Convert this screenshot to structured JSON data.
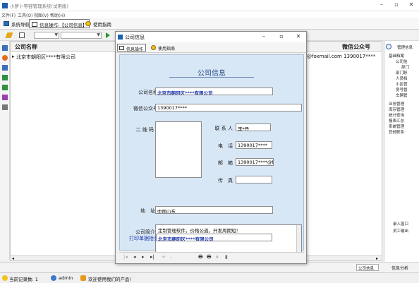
{
  "app": {
    "title": "小萝卜等容管理系统(试用版)"
  },
  "menu": [
    "文件(F)",
    "工具(O)",
    "视图(V)",
    "帮助(H)"
  ],
  "tabs": [
    {
      "label": "系统导航",
      "active": false
    },
    {
      "label": "信息操作-【公司信息】",
      "active": true
    },
    {
      "label": "使用指南",
      "active": false
    }
  ],
  "grid": {
    "col_company": "公司名称",
    "col_wechat": "微信公众号",
    "row1_company": "北京市朝阳区****有限公司",
    "row1_tail": "@foxmail.com 1390017****"
  },
  "right_panel": {
    "header": "管理信息",
    "tree": [
      "基础档案",
      "公司信",
      "部门",
      "部门职",
      "人员档",
      "小区管",
      "房号管",
      "车辆管",
      "业务管理",
      "库存管理",
      "统计查询",
      "报表汇总",
      "系统管理",
      "其他联系"
    ],
    "bottom": [
      "录入窗口",
      "员工输出"
    ]
  },
  "bottom_bar": {
    "dropdown": "公司信息",
    "right_label": "信息分析"
  },
  "status": {
    "records": "当前记录数: 1",
    "user": "admin",
    "welcome": "欢迎使用我们的产品!"
  },
  "dialog": {
    "title": "公司信息",
    "toolbar": [
      {
        "label": "信息操作",
        "active": true
      },
      {
        "label": "使用指南",
        "active": false
      }
    ],
    "form_title": "公司信息",
    "fields": {
      "company_label": "公司名称",
      "company_value": "北京市朝阳区****有限公司",
      "wechat_label": "微信公众号",
      "wechat_value": "1390017****",
      "qrcode_label": "二 维 码",
      "contact_label": "联 系 人",
      "contact_value": "李*丹",
      "phone_label": "电　话",
      "phone_value": "1390017****",
      "email_label": "邮　箱",
      "email_value": "1390017****@fo",
      "fax_label": "传　真",
      "fax_value": "",
      "address_label": "地　址",
      "address_value": "中国山东",
      "intro_label": "公司简介",
      "intro_value": "定制管理软件，价格公道，开发周期短！",
      "print_label": "打印单据抬头",
      "print_value": "北京市朝阳区****有限公司"
    }
  }
}
